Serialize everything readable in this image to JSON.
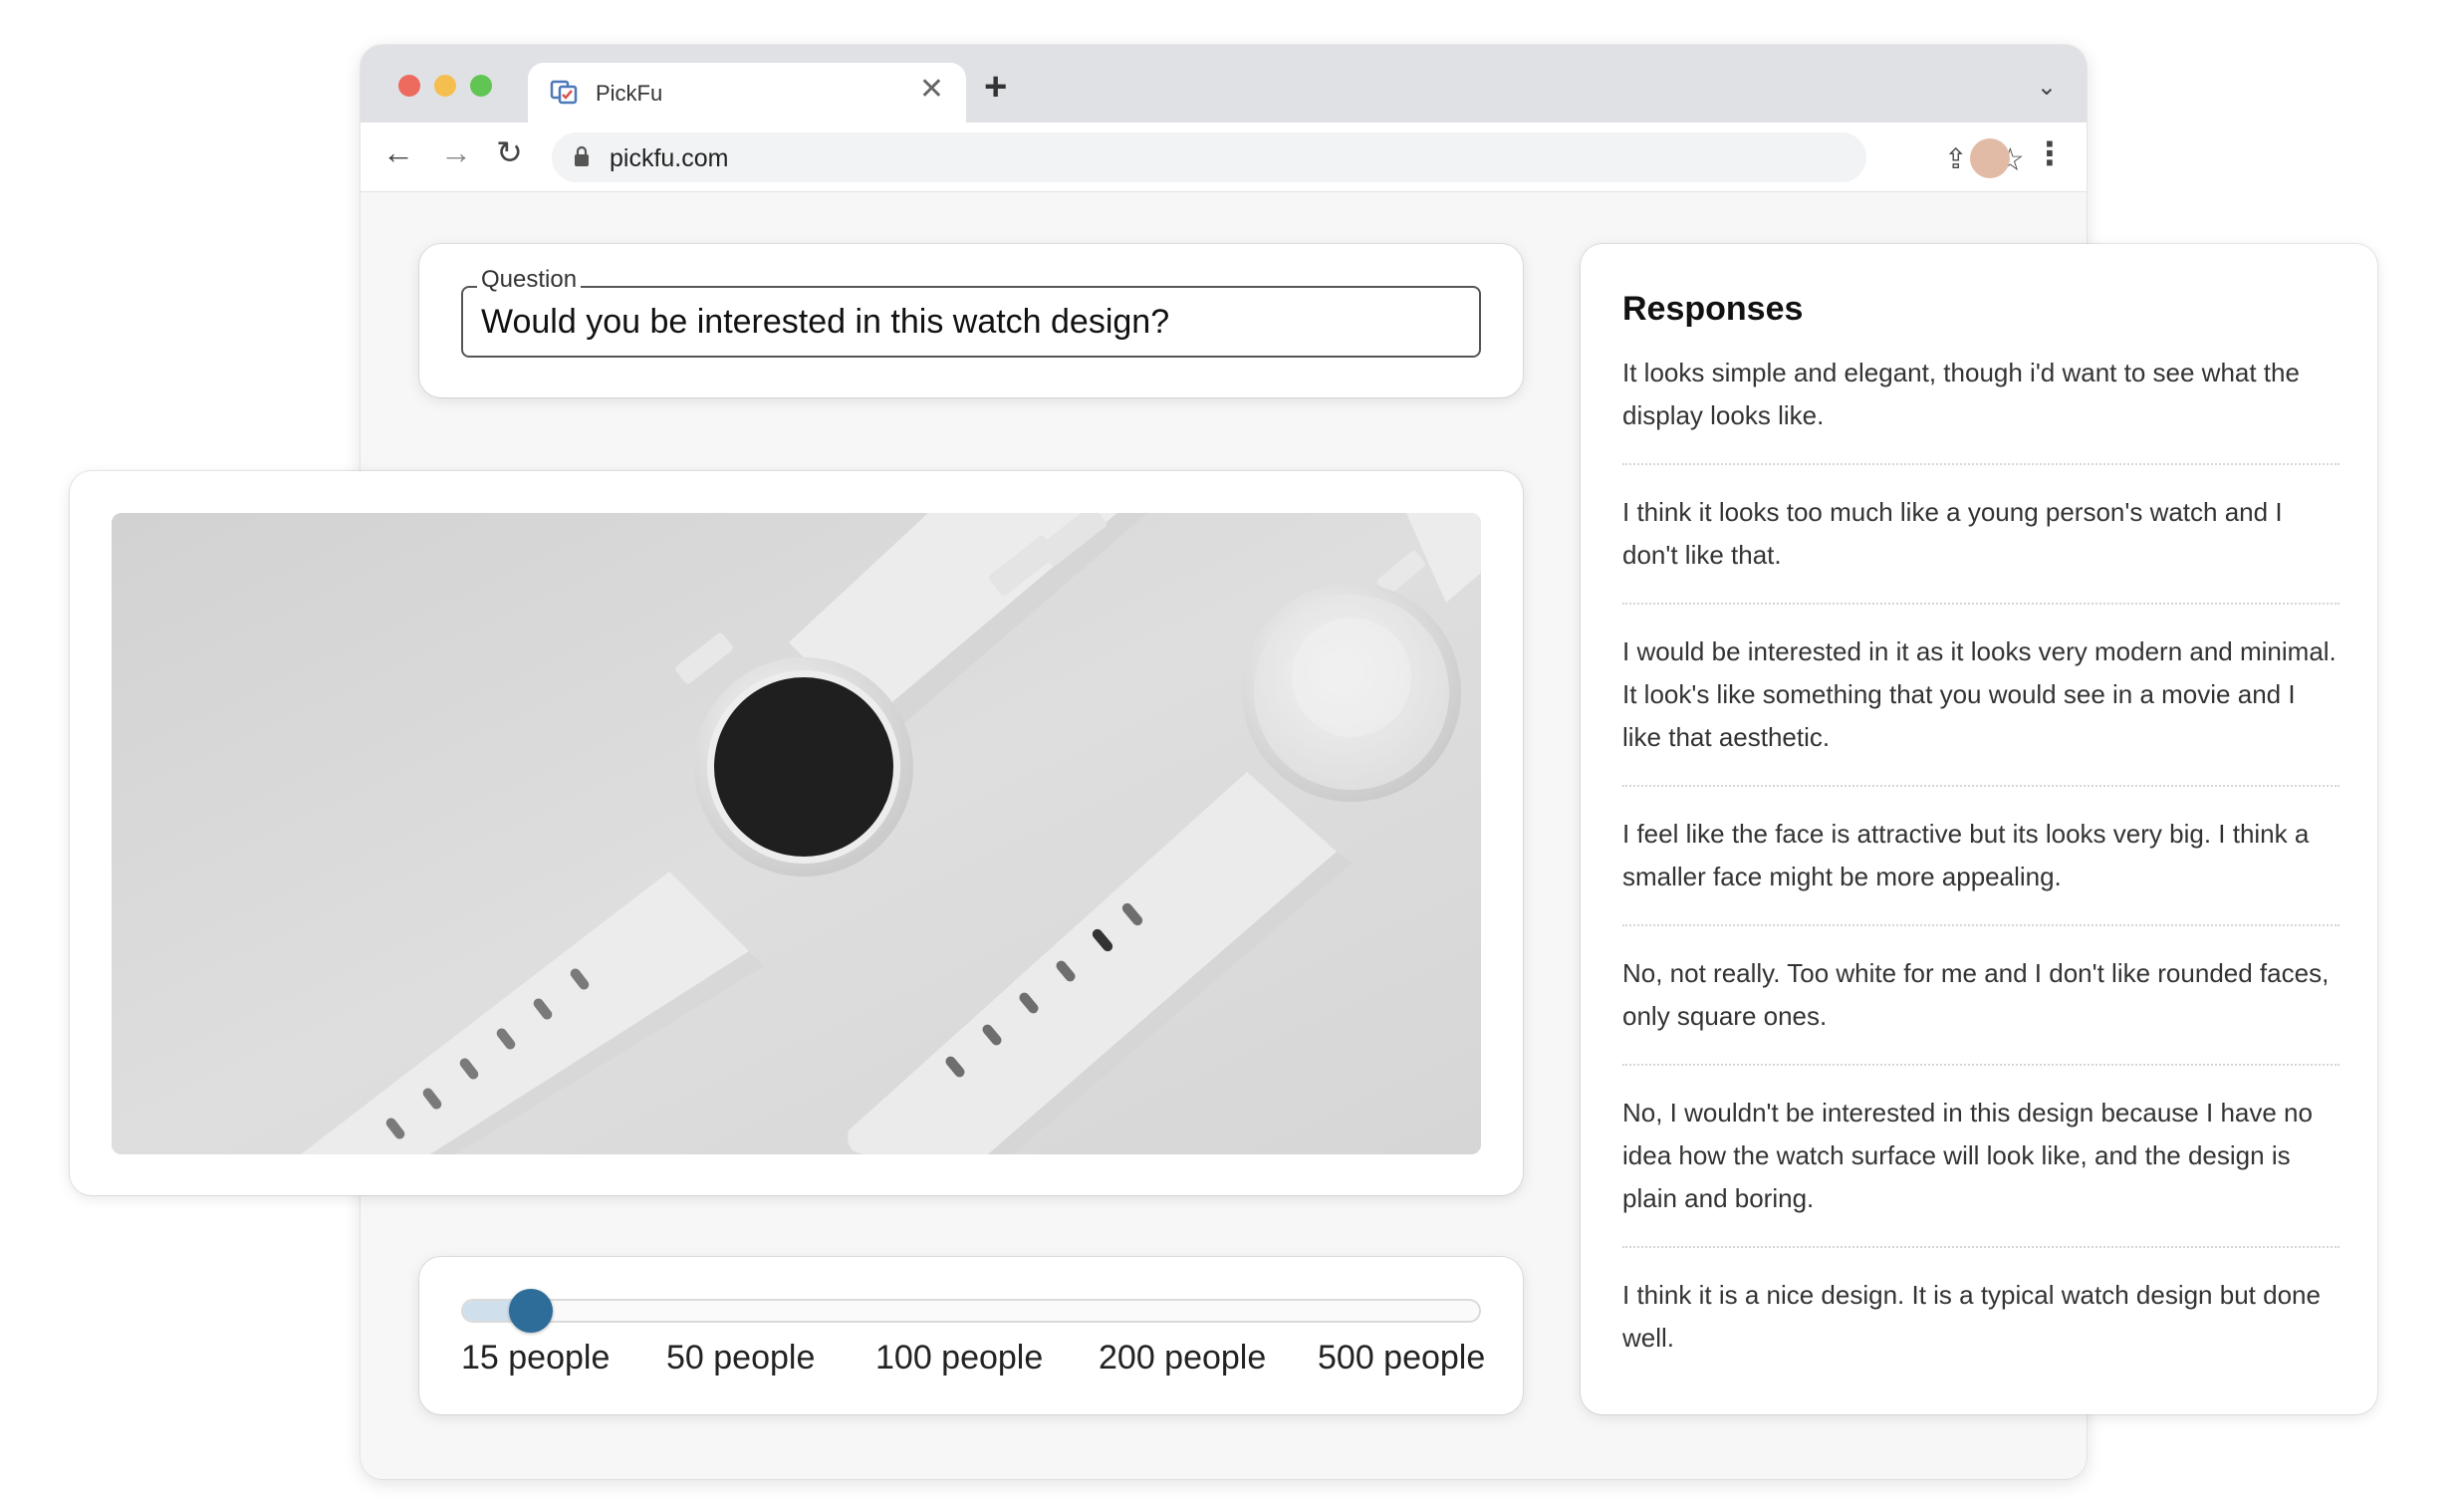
{
  "browser": {
    "tab_title": "PickFu",
    "tab_icon": "pickfu-favicon-icon",
    "url": "pickfu.com",
    "colors": {
      "close": "#ec6a5e",
      "minimize": "#f4bf4f",
      "zoom": "#61c554"
    }
  },
  "question": {
    "label": "Question",
    "value": "Would you be interested in this watch design?"
  },
  "image": {
    "icon": "watch-product-photo"
  },
  "audience": {
    "options": [
      "15 people",
      "50 people",
      "100 people",
      "200 people",
      "500 people"
    ],
    "selected": "15 people",
    "accent_color": "#2e6c9a"
  },
  "responses": {
    "title": "Responses",
    "items": [
      "It looks simple and elegant, though i'd want to see what the display looks like.",
      "I think it looks too much like a young person's watch and I don't like that.",
      "I would be interested in it as it looks very modern and minimal. It look's like something that you would see in a movie and I like that aesthetic.",
      "I feel like the face is attractive but its looks very big. I think a smaller face might be more appealing.",
      "No, not really. Too white for me and I don't like rounded faces, only square ones.",
      "No, I wouldn't be interested in this design because I have no idea how the watch surface will look like, and the design is plain and boring.",
      "I think it is a nice design. It is a typical watch design but done well."
    ]
  }
}
